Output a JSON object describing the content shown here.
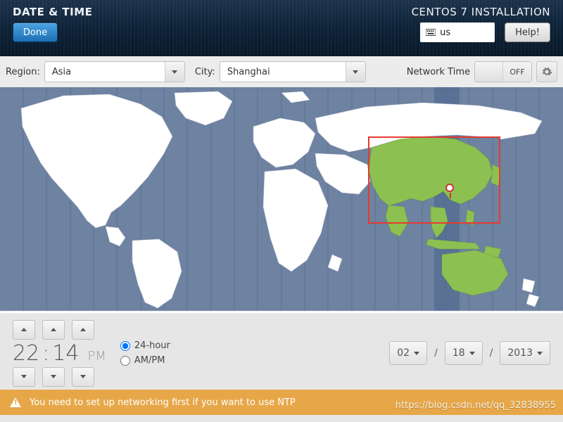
{
  "header": {
    "title": "DATE & TIME",
    "done": "Done",
    "install_title": "CENTOS 7 INSTALLATION",
    "keyboard_layout": "us",
    "help": "Help!"
  },
  "selectors": {
    "region_label": "Region:",
    "region_value": "Asia",
    "city_label": "City:",
    "city_value": "Shanghai",
    "network_time_label": "Network Time",
    "network_time_state": "OFF"
  },
  "map": {
    "highlight_region": "Asia",
    "pin_city": "Shanghai"
  },
  "time": {
    "hour": "22",
    "sep": ":",
    "minute": "14",
    "ampm": "PM",
    "mode_24": "24-hour",
    "mode_ampm": "AM/PM",
    "mode_selected": "24-hour"
  },
  "date": {
    "month": "02",
    "day": "18",
    "year": "2013",
    "separator": "/"
  },
  "footer": {
    "warning": "You need to set up networking first if you want to use NTP",
    "watermark": "https://blog.csdn.net/qq_32838955"
  },
  "colors": {
    "highlight_green": "#7db54a",
    "map_bg": "#6e82a1",
    "red_box": "#e53a2e",
    "footer_bg": "#e7a749"
  }
}
